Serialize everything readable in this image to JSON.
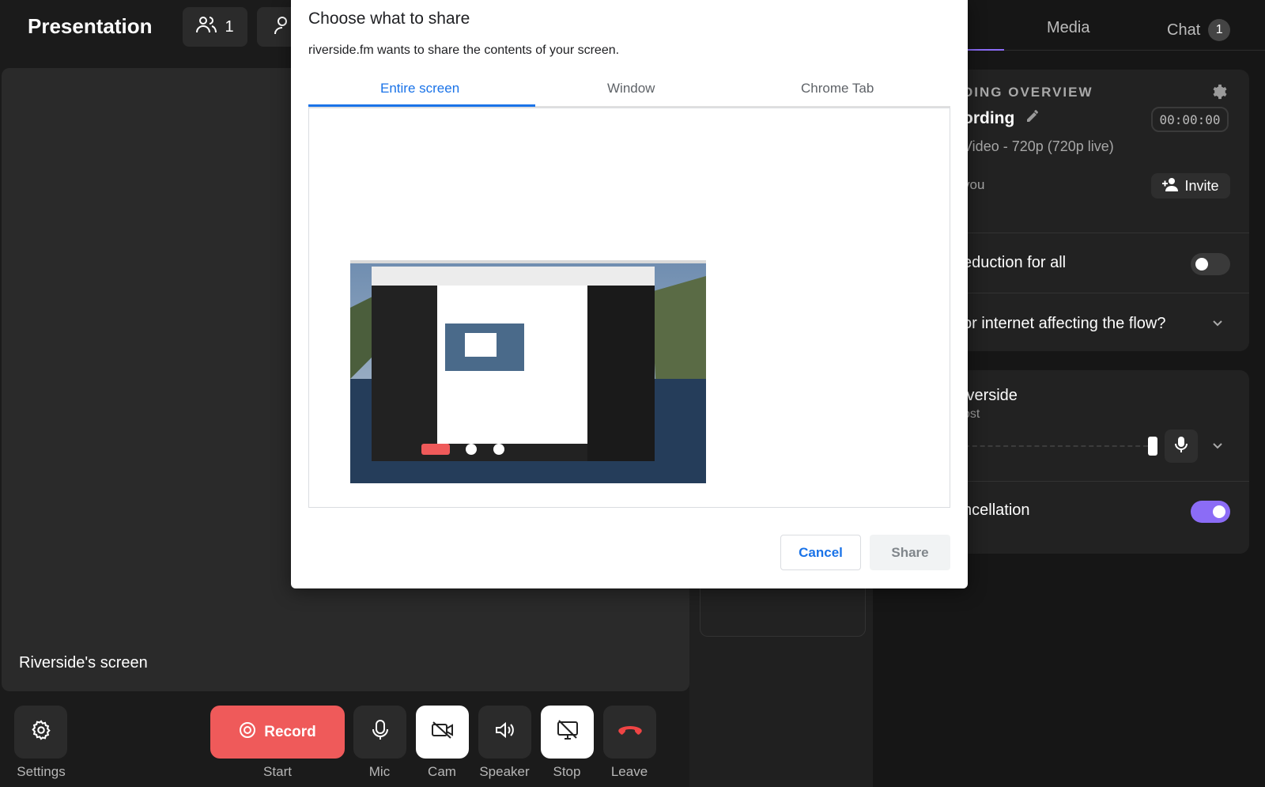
{
  "app": {
    "title": "Presentation"
  },
  "header": {
    "participants_count": "1"
  },
  "stage": {
    "label": "Riverside's screen"
  },
  "right_panel": {
    "tabs": [
      {
        "label": "Media"
      },
      {
        "label": "Chat",
        "badge": "1"
      }
    ],
    "recording": {
      "overview_label": "DING OVERVIEW",
      "title": "ording",
      "timer": "00:00:00",
      "quality": "Video - 720p (720p live)",
      "you_label": "you",
      "invite_label": "Invite"
    },
    "noise_reduction_label": "eduction for all",
    "noise_reduction_on": false,
    "internet_question": "or internet affecting the flow?",
    "participant": {
      "name": "iverside",
      "role": "ost"
    },
    "echo_cancellation_label": "ncellation",
    "echo_cancellation_on": true
  },
  "controls": {
    "settings_label": "Settings",
    "record_label": "Record",
    "start_label": "Start",
    "mic_label": "Mic",
    "cam_label": "Cam",
    "speaker_label": "Speaker",
    "stop_label": "Stop",
    "leave_label": "Leave"
  },
  "dialog": {
    "title": "Choose what to share",
    "subtitle": "riverside.fm wants to share the contents of your screen.",
    "tabs": [
      {
        "label": "Entire screen",
        "active": true
      },
      {
        "label": "Window",
        "active": false
      },
      {
        "label": "Chrome Tab",
        "active": false
      }
    ],
    "cancel_label": "Cancel",
    "share_label": "Share"
  },
  "colors": {
    "accent": "#8b6cf6",
    "record": "#ef5a5a",
    "link_blue": "#1a73e8"
  }
}
